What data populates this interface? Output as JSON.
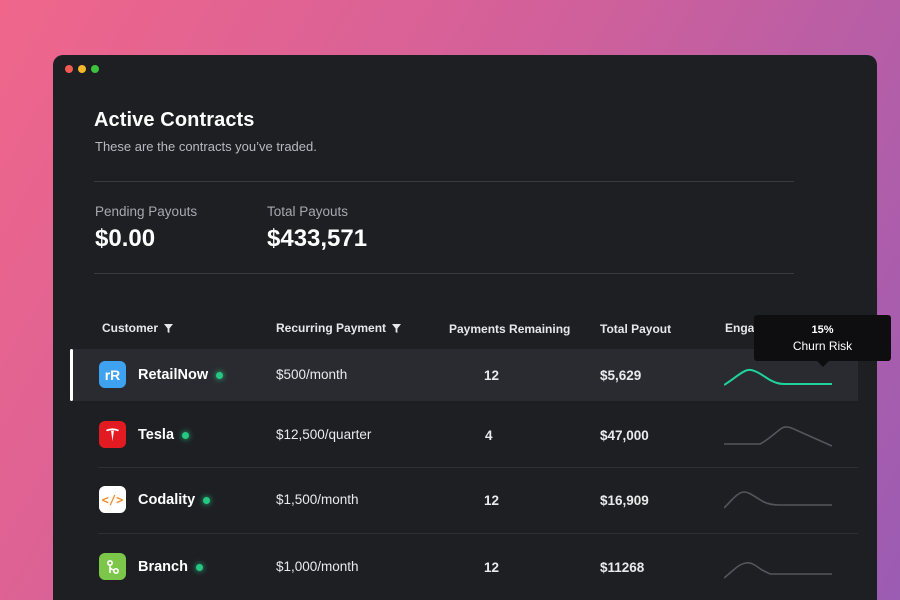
{
  "page": {
    "title": "Active Contracts",
    "subtitle": "These are the contracts you’ve traded."
  },
  "stats": {
    "pending": {
      "label": "Pending Payouts",
      "value": "$0.00"
    },
    "total": {
      "label": "Total Payouts",
      "value": "$433,571"
    }
  },
  "table": {
    "headers": {
      "customer": "Customer",
      "recurring": "Recurring Payment",
      "remaining": "Payments Remaining",
      "payout": "Total Payout",
      "engagement": "Engag"
    },
    "rows": [
      {
        "customer": "RetailNow",
        "logo_text": "rR",
        "logo_color": "#3ea2f0",
        "recurring": "$500/month",
        "remaining": "12",
        "payout": "$5,629",
        "status": "active",
        "spark_color": "#1fd39a"
      },
      {
        "customer": "Tesla",
        "logo_text": "T",
        "logo_color": "#e21b23",
        "recurring": "$12,500/quarter",
        "remaining": "4",
        "payout": "$47,000",
        "status": "active",
        "spark_color": "#55565b"
      },
      {
        "customer": "Codality",
        "logo_text": "</>",
        "logo_color": "#ffffff",
        "recurring": "$1,500/month",
        "remaining": "12",
        "payout": "$16,909",
        "status": "active",
        "spark_color": "#55565b"
      },
      {
        "customer": "Branch",
        "logo_text": "",
        "logo_color": "#7cc64a",
        "recurring": "$1,000/month",
        "remaining": "12",
        "payout": "$11268",
        "status": "active",
        "spark_color": "#55565b"
      }
    ]
  },
  "tooltip": {
    "value": "15%",
    "label": "Churn Risk"
  },
  "icons": {
    "filter": "filter-icon",
    "window_controls": [
      "close-dot",
      "minimize-dot",
      "maximize-dot"
    ]
  },
  "colors": {
    "status_active": "#26c783",
    "highlight_spark": "#1fd39a"
  }
}
